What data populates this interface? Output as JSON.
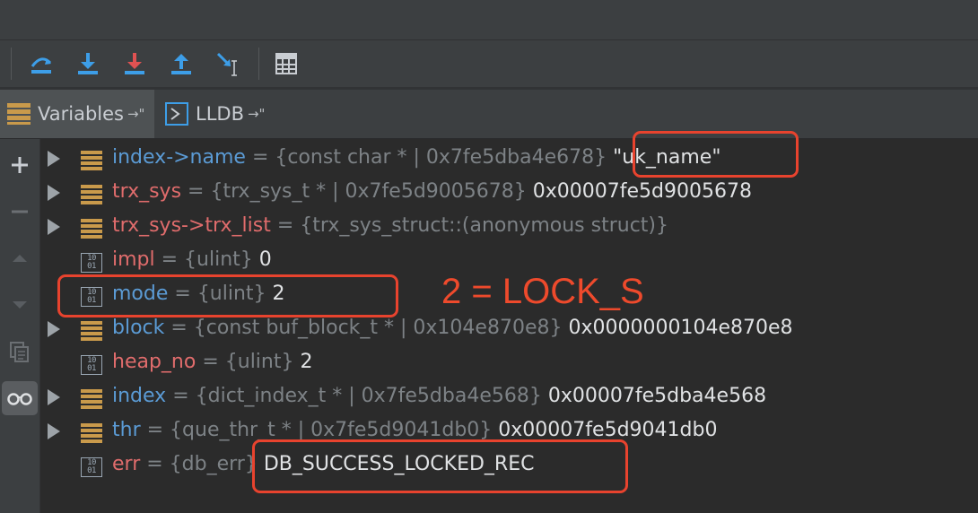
{
  "tabs": [
    {
      "label": "Variables",
      "pin": "→\"",
      "icon": "variables-icon"
    },
    {
      "label": "LLDB",
      "pin": "→\"",
      "icon": "terminal-icon"
    }
  ],
  "variables": [
    {
      "name": "index->name",
      "eq": " = ",
      "type": "{const char * | 0x7fe5dba4e678}",
      "value": " \"uk_name\""
    },
    {
      "name": "trx_sys",
      "eq": " = ",
      "type": "{trx_sys_t * | 0x7fe5d9005678}",
      "value": " 0x00007fe5d9005678"
    },
    {
      "name": "trx_sys->trx_list",
      "eq": " = ",
      "type": "{trx_sys_struct::(anonymous struct)}",
      "value": ""
    },
    {
      "name": "impl",
      "eq": " = ",
      "type": "{ulint}",
      "value": " 0"
    },
    {
      "name": "mode",
      "eq": " = ",
      "type": "{ulint}",
      "value": " 2"
    },
    {
      "name": "block",
      "eq": " = ",
      "type": "{const buf_block_t * | 0x104e870e8}",
      "value": " 0x0000000104e870e8"
    },
    {
      "name": "heap_no",
      "eq": " = ",
      "type": "{ulint}",
      "value": " 2"
    },
    {
      "name": "index",
      "eq": " = ",
      "type": "{dict_index_t * | 0x7fe5dba4e568}",
      "value": " 0x00007fe5dba4e568"
    },
    {
      "name": "thr",
      "eq": " = ",
      "type": "{que_thr_t * | 0x7fe5d9041db0}",
      "value": " 0x00007fe5d9041db0"
    },
    {
      "name": "err",
      "eq": " = ",
      "type": "{db_err}",
      "value": " DB_SUCCESS_LOCKED_REC"
    }
  ],
  "annotation": "2 = LOCK_S",
  "colors": {
    "highlight": "#e8432e",
    "annotation": "#ee4a2c",
    "name_blue": "#5b9bd5",
    "name_red": "#e06c6c"
  }
}
